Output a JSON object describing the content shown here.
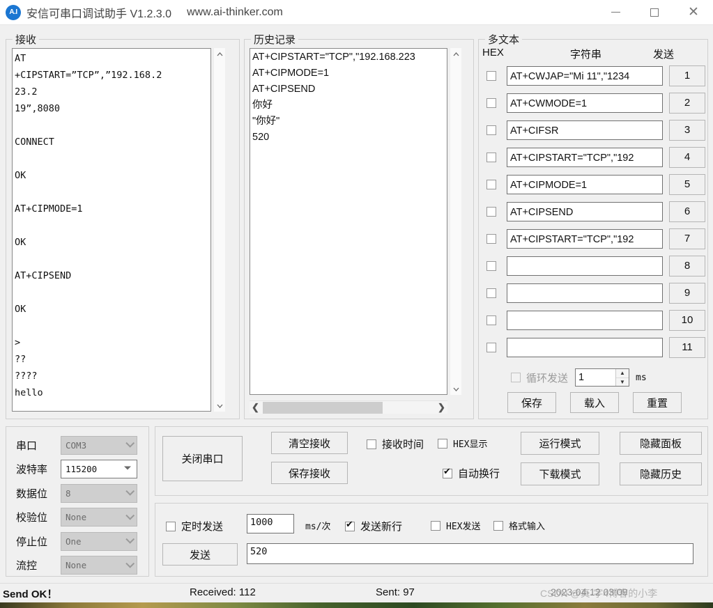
{
  "window": {
    "icon": "app-logo-icon",
    "icon_text": "A.I",
    "title": "安信可串口调试助手 V1.2.3.0",
    "url": "www.ai-thinker.com",
    "minimize": "—",
    "maximize": "□",
    "close": "✕"
  },
  "receive": {
    "legend": "接收",
    "content": "AT\n+CIPSTART=”TCP”,”192.168.2\n23.2\n19”,8080\n\nCONNECT\n\nOK\n\nAT+CIPMODE=1\n\nOK\n\nAT+CIPSEND\n\nOK\n\n>\n??\n????\nhello",
    "scroll_up": "⌃",
    "scroll_down": "⌄"
  },
  "history": {
    "legend": "历史记录",
    "content": "AT+CIPSTART=\"TCP\",\"192.168.223\nAT+CIPMODE=1\nAT+CIPSEND\n你好\n\"你好\"\n520",
    "scroll_up": "⌃",
    "scroll_down": "⌄",
    "scroll_left": "❮",
    "scroll_right": "❯"
  },
  "multitext": {
    "legend": "多文本",
    "col_hex": "HEX",
    "col_string": "字符串",
    "col_send": "发送",
    "rows": [
      {
        "checked": false,
        "text": "AT+CWJAP=\"Mi 11\",\"1234",
        "button": "1"
      },
      {
        "checked": false,
        "text": "AT+CWMODE=1",
        "button": "2"
      },
      {
        "checked": false,
        "text": "AT+CIFSR",
        "button": "3"
      },
      {
        "checked": false,
        "text": "AT+CIPSTART=\"TCP\",\"192",
        "button": "4"
      },
      {
        "checked": false,
        "text": "AT+CIPMODE=1",
        "button": "5"
      },
      {
        "checked": false,
        "text": "AT+CIPSEND",
        "button": "6"
      },
      {
        "checked": false,
        "text": "AT+CIPSTART=\"TCP\",\"192",
        "button": "7"
      },
      {
        "checked": false,
        "text": "",
        "button": "8"
      },
      {
        "checked": false,
        "text": "",
        "button": "9"
      },
      {
        "checked": false,
        "text": "",
        "button": "10"
      },
      {
        "checked": false,
        "text": "",
        "button": "11"
      }
    ],
    "loop_send_label": "循环发送",
    "loop_interval": "1",
    "loop_unit": "ms",
    "spin_up": "▲",
    "spin_down": "▼",
    "save_label": "保存",
    "load_label": "载入",
    "reset_label": "重置"
  },
  "serial": {
    "rows": [
      {
        "label": "串口",
        "value": "COM3",
        "enabled": false
      },
      {
        "label": "波特率",
        "value": "115200",
        "enabled": true
      },
      {
        "label": "数据位",
        "value": "8",
        "enabled": false
      },
      {
        "label": "校验位",
        "value": "None",
        "enabled": false
      },
      {
        "label": "停止位",
        "value": "One",
        "enabled": false
      },
      {
        "label": "流控",
        "value": "None",
        "enabled": false
      }
    ]
  },
  "controls": {
    "close_port": "关闭串口",
    "clear_recv": "清空接收",
    "save_recv": "保存接收",
    "recv_time_label": "接收时间",
    "recv_time_checked": false,
    "hex_show_label": "HEX显示",
    "hex_show_checked": false,
    "auto_wrap_label": "自动换行",
    "auto_wrap_checked": true,
    "run_mode": "运行模式",
    "download_mode": "下载模式",
    "hide_panel": "隐藏面板",
    "hide_history": "隐藏历史"
  },
  "send": {
    "timed_send_label": "定时发送",
    "timed_send_checked": false,
    "interval_value": "1000",
    "interval_unit": "ms/次",
    "send_newline_label": "发送新行",
    "send_newline_checked": true,
    "hex_send_label": "HEX发送",
    "hex_send_checked": false,
    "format_input_label": "格式输入",
    "format_input_checked": false,
    "send_button": "发送",
    "send_text": "520"
  },
  "status": {
    "message": "Send OK！",
    "received": "Received: 112",
    "sent": "Sent: 97",
    "watermark": "CSDN @真-字4博客的小李",
    "timestamp": "2023-04-12 03:09"
  },
  "colors": {
    "accent": "#1a76d2",
    "window_bg": "#f0f0f0",
    "field_bg": "#ffffff",
    "border": "#d0d0d0",
    "disabled": "#cfcfcf"
  }
}
